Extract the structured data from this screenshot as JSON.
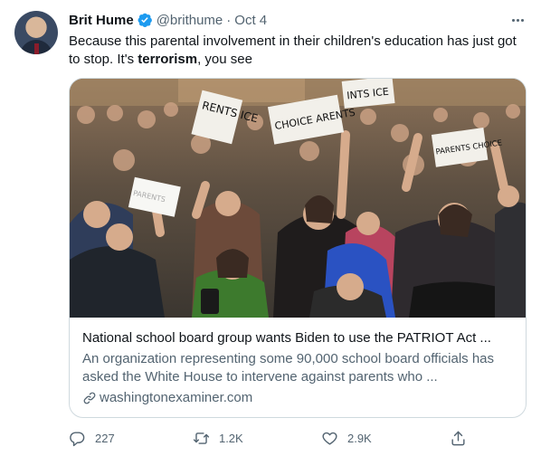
{
  "author": {
    "name": "Brit Hume",
    "handle": "@brithume",
    "separator": "·",
    "date": "Oct 4"
  },
  "tweet": {
    "text_before": "Because this parental involvement in their children's education has just got to stop. It's ",
    "text_bold": "terrorism",
    "text_after": ", you see"
  },
  "card": {
    "title": "National school board group wants Biden to use the PATRIOT Act ...",
    "description": "An organization representing some 90,000 school board officials has asked the White House to intervene against parents who ...",
    "domain": "washingtonexaminer.com",
    "photo_signs": {
      "sign_a": "RENTS ICE",
      "sign_b": "CHOICE ARENTS",
      "sign_c": "INTS ICE",
      "sign_d": "PARENTS CHOICE",
      "sign_e": "PARENTS"
    }
  },
  "actions": {
    "reply_count": "227",
    "retweet_count": "1.2K",
    "like_count": "2.9K"
  },
  "colors": {
    "verified": "#1d9bf0",
    "muted": "#536471",
    "border": "#cfd9de"
  }
}
